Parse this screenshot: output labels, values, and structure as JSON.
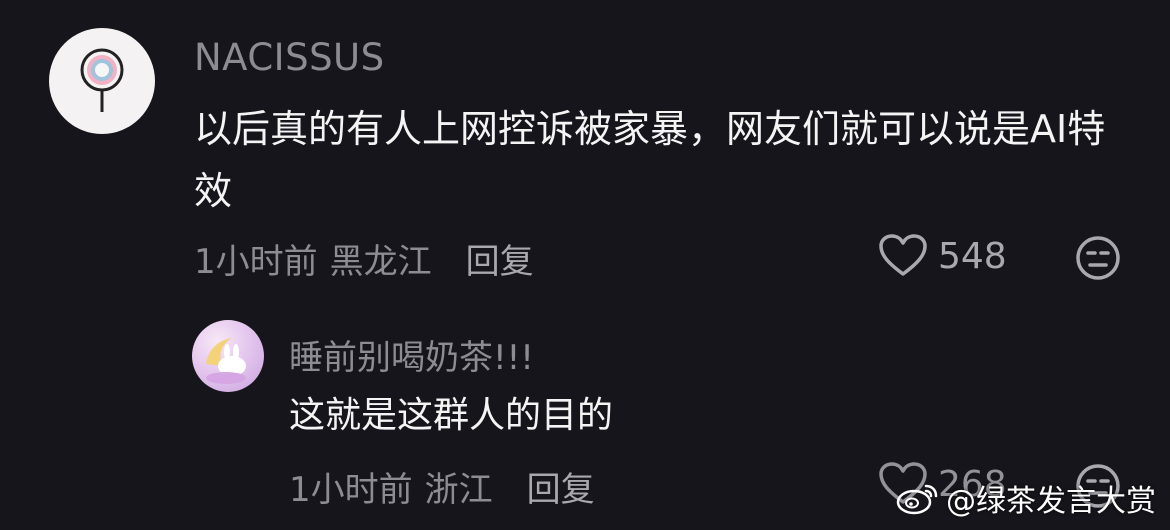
{
  "comments": [
    {
      "username": "NACISSUS",
      "text": "以后真的有人上网控诉被家暴，网友们就可以说是AI特效",
      "time": "1小时前",
      "location": "黑龙江",
      "reply_label": "回复",
      "likes": "548"
    },
    {
      "username": "睡前别喝奶茶!!!",
      "text": "这就是这群人的目的",
      "time": "1小时前",
      "location": "浙江",
      "reply_label": "回复",
      "likes": "268"
    }
  ],
  "watermark": {
    "handle": "@绿茶发言大赏"
  },
  "colors": {
    "background": "#16151b",
    "secondary_text": "#8d8c92",
    "primary_text": "#f4f4f4"
  }
}
